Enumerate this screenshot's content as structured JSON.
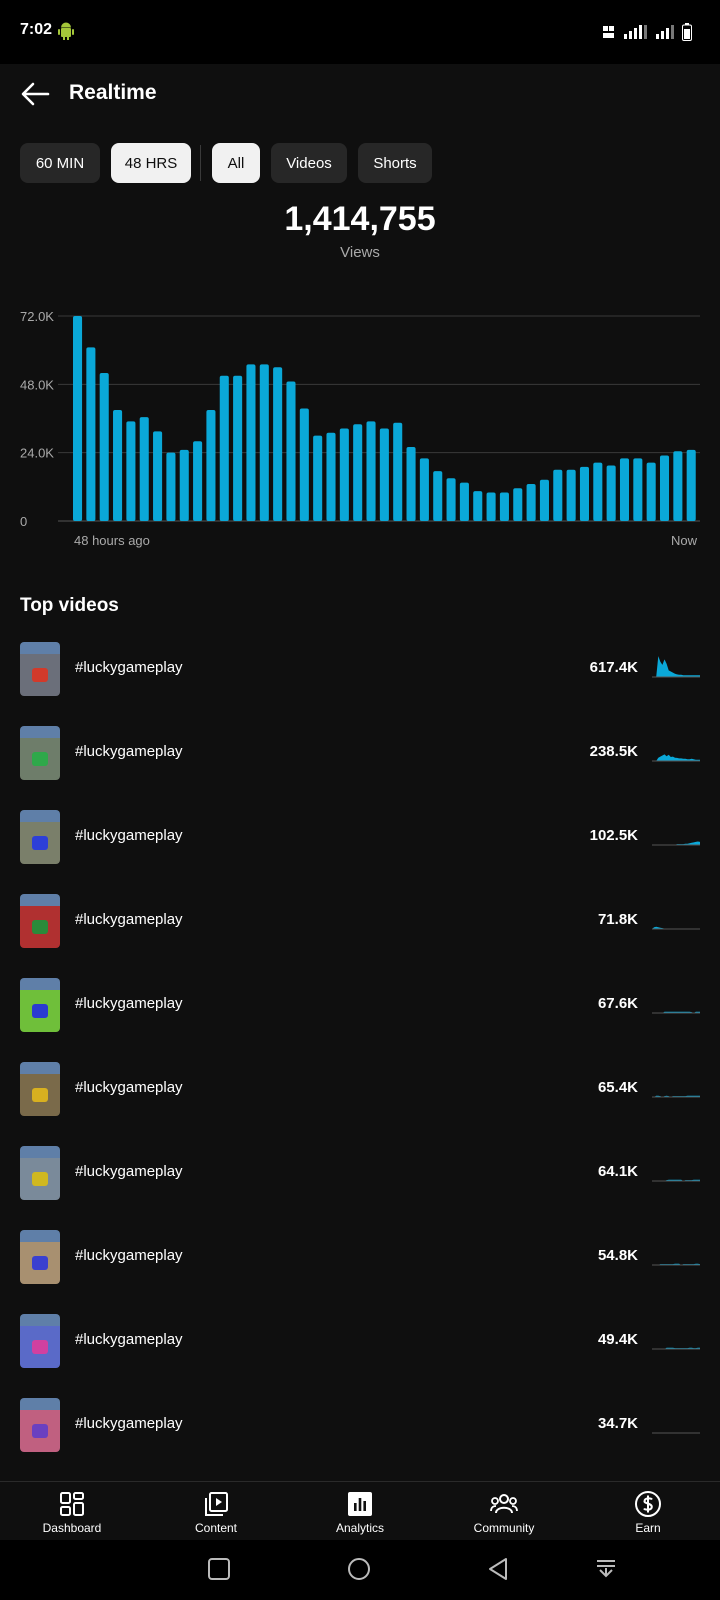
{
  "status": {
    "time": "7:02"
  },
  "header": {
    "title": "Realtime"
  },
  "filters": {
    "time_ranges": [
      {
        "label": "60 MIN",
        "selected": false
      },
      {
        "label": "48 HRS",
        "selected": true
      }
    ],
    "content_types": [
      {
        "label": "All",
        "selected": true
      },
      {
        "label": "Videos",
        "selected": false
      },
      {
        "label": "Shorts",
        "selected": false
      }
    ]
  },
  "summary": {
    "total": "1,414,755",
    "label": "Views"
  },
  "chart_data": {
    "type": "bar",
    "y_ticks": [
      "72.0K",
      "48.0K",
      "24.0K",
      "0"
    ],
    "ylim": [
      0,
      72000
    ],
    "x_start_label": "48 hours ago",
    "x_end_label": "Now",
    "color": "#0aa8d8",
    "values": [
      72000,
      61000,
      52000,
      39000,
      35000,
      36500,
      31500,
      24000,
      25000,
      28000,
      39000,
      51000,
      51000,
      55000,
      55000,
      54000,
      49000,
      39500,
      30000,
      31000,
      32500,
      34000,
      35000,
      32500,
      34500,
      26000,
      22000,
      17500,
      15000,
      13500,
      10500,
      10000,
      10000,
      11500,
      13000,
      14500,
      18000,
      18000,
      19000,
      20500,
      19500,
      22000,
      22000,
      20500,
      23000,
      24500,
      25000
    ],
    "grid": true
  },
  "top_videos": {
    "title": "Top videos",
    "items": [
      {
        "title": "#luckygameplay",
        "views": "617.4K",
        "spark": [
          0,
          0,
          0,
          95,
          70,
          55,
          80,
          60,
          30,
          25,
          20,
          15,
          12,
          10,
          10,
          8,
          8,
          8,
          8,
          8,
          8,
          8,
          8,
          8
        ]
      },
      {
        "title": "#luckygameplay",
        "views": "238.5K",
        "spark": [
          0,
          0,
          0,
          15,
          20,
          25,
          30,
          22,
          28,
          18,
          20,
          15,
          14,
          12,
          12,
          10,
          10,
          8,
          8,
          10,
          8,
          6,
          6,
          6
        ]
      },
      {
        "title": "#luckygameplay",
        "views": "102.5K",
        "spark": [
          0,
          0,
          0,
          0,
          0,
          0,
          0,
          0,
          0,
          0,
          0,
          0,
          4,
          4,
          4,
          4,
          6,
          6,
          8,
          10,
          12,
          14,
          16,
          14
        ]
      },
      {
        "title": "#luckygameplay",
        "views": "71.8K",
        "spark": [
          0,
          8,
          10,
          8,
          6,
          4,
          2,
          2,
          2,
          2,
          2,
          2,
          2,
          2,
          2,
          2,
          2,
          2,
          2,
          2,
          2,
          2,
          2,
          2
        ]
      },
      {
        "title": "#luckygameplay",
        "views": "67.6K",
        "spark": [
          0,
          0,
          0,
          0,
          0,
          0,
          6,
          6,
          6,
          6,
          6,
          6,
          6,
          6,
          6,
          6,
          6,
          6,
          6,
          4,
          0,
          6,
          6,
          6
        ]
      },
      {
        "title": "#luckygameplay",
        "views": "65.4K",
        "spark": [
          0,
          0,
          6,
          6,
          4,
          0,
          4,
          6,
          4,
          0,
          4,
          4,
          4,
          4,
          4,
          4,
          4,
          6,
          6,
          6,
          6,
          6,
          6,
          6
        ]
      },
      {
        "title": "#luckygameplay",
        "views": "64.1K",
        "spark": [
          0,
          0,
          0,
          0,
          0,
          0,
          0,
          4,
          6,
          6,
          6,
          6,
          6,
          6,
          6,
          0,
          4,
          4,
          4,
          4,
          6,
          6,
          6,
          6
        ]
      },
      {
        "title": "#luckygameplay",
        "views": "54.8K",
        "spark": [
          0,
          0,
          0,
          0,
          4,
          4,
          4,
          4,
          4,
          4,
          4,
          6,
          6,
          6,
          0,
          4,
          4,
          4,
          4,
          4,
          4,
          6,
          6,
          4
        ]
      },
      {
        "title": "#luckygameplay",
        "views": "49.4K",
        "spark": [
          0,
          0,
          0,
          0,
          0,
          0,
          0,
          6,
          6,
          6,
          6,
          4,
          4,
          4,
          4,
          4,
          4,
          4,
          6,
          6,
          4,
          4,
          6,
          6
        ]
      },
      {
        "title": "#luckygameplay",
        "views": "34.7K",
        "spark": [
          0,
          0,
          0,
          0,
          0,
          0,
          0,
          0,
          0,
          0,
          0,
          0,
          0,
          0,
          0,
          0,
          0,
          0,
          0,
          0,
          0,
          0,
          0,
          0
        ]
      }
    ]
  },
  "bottom_nav": [
    {
      "label": "Dashboard",
      "icon": "dashboard-icon"
    },
    {
      "label": "Content",
      "icon": "content-icon"
    },
    {
      "label": "Analytics",
      "icon": "analytics-icon",
      "active": true
    },
    {
      "label": "Community",
      "icon": "community-icon"
    },
    {
      "label": "Earn",
      "icon": "earn-icon"
    }
  ],
  "colors": {
    "accent": "#0aa8d8",
    "background": "#0f0f0f",
    "chip": "#272727",
    "chip_selected": "#f1f1f1"
  }
}
